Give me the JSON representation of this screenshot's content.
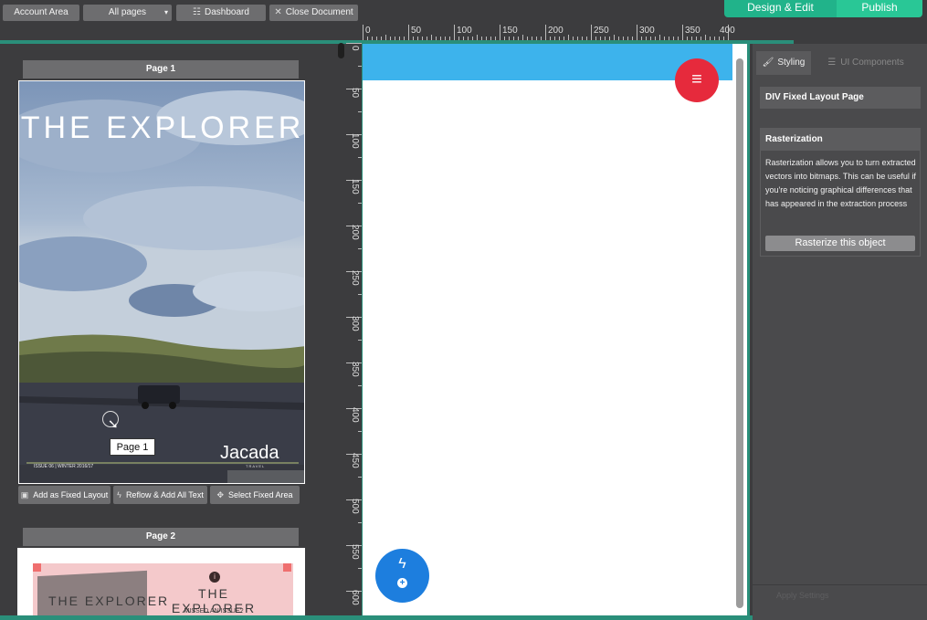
{
  "toolbar": {
    "account_area": "Account Area",
    "all_pages": "All pages",
    "dashboard": "Dashboard",
    "close_document": "Close Document",
    "design_edit": "Design & Edit",
    "publish": "Publish"
  },
  "ruler": {
    "top_labels": [
      "0",
      "50",
      "100",
      "150",
      "200",
      "250",
      "300",
      "350",
      "400"
    ],
    "left_labels": [
      "0",
      "50",
      "100",
      "150",
      "200",
      "250",
      "300",
      "350",
      "400",
      "450",
      "500",
      "550",
      "600"
    ]
  },
  "pages": {
    "page1": {
      "header": "Page 1",
      "cover_title": "THE EXPLORER",
      "issue_text": "ISSUE 06 | WINTER 2016/17",
      "brand": "Jacada",
      "brand_sub": "TRAVEL",
      "tooltip": "Page 1"
    },
    "page2": {
      "header": "Page 2",
      "left_title": "THE EXPLORER",
      "right_title": "THE EXPLORER",
      "missed_text": "MISSED AN ISSUE?"
    },
    "buttons": {
      "add_fixed": "Add as Fixed Layout",
      "reflow": "Reflow & Add All Text",
      "select_fixed": "Select Fixed Area"
    }
  },
  "inspector": {
    "tabs": {
      "styling": "Styling",
      "ui_components": "UI Components"
    },
    "element_tag": "DIV",
    "element_name": "Fixed Layout Page",
    "rasterization": {
      "title": "Rasterization",
      "description": "Rasterization allows you to turn extracted vectors into bitmaps. This can be useful if you're noticing graphical differences that has appeared in the extraction process",
      "button": "Rasterize this object"
    },
    "apply": "Apply Settings"
  },
  "colors": {
    "accent_green": "#21b38a",
    "publish_green": "#29c796",
    "banner_blue": "#3db3ec",
    "fab_red": "#e62a3c",
    "fab_blue": "#1d7ede"
  }
}
